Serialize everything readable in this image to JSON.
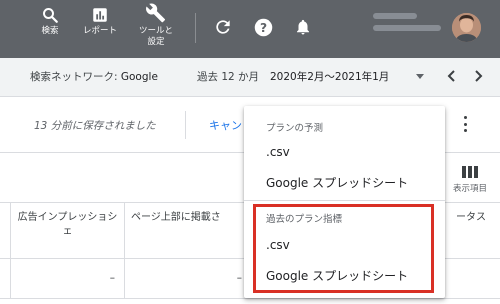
{
  "topbar": {
    "search_label": "検索",
    "reports_label": "レポート",
    "tools_label_line1": "ツールと",
    "tools_label_line2": "設定"
  },
  "filters": {
    "network_label": "検索ネットワーク: ",
    "network_value": "Google",
    "period_label": "過去 12 か月",
    "period_value": "2020年2月～2021年1月"
  },
  "save_row": {
    "saved_message": "13 分前に保存されました",
    "cancel_label": "キャン"
  },
  "table": {
    "columns_button_label": "表示項目",
    "headers": [
      "広告インプレッショシェ",
      "ページ上部に掲載さ",
      "ータス"
    ],
    "rows": [
      [
        "–",
        "–"
      ]
    ]
  },
  "menu": {
    "section1_header": "プランの予測",
    "section1_items": [
      ".csv",
      "Google スプレッドシート"
    ],
    "section2_header": "過去のプラン指標",
    "section2_items": [
      ".csv",
      "Google スプレッドシート"
    ]
  },
  "colors": {
    "topbar_bg": "#5f6368",
    "link_blue": "#1a73e8",
    "highlight_red": "#d93025"
  },
  "icons": [
    "search-icon",
    "bar-chart-icon",
    "wrench-icon",
    "refresh-icon",
    "help-icon",
    "bell-icon",
    "chevron-left-icon",
    "chevron-right-icon",
    "more-vert-icon",
    "columns-icon",
    "dropdown-arrow-icon"
  ]
}
